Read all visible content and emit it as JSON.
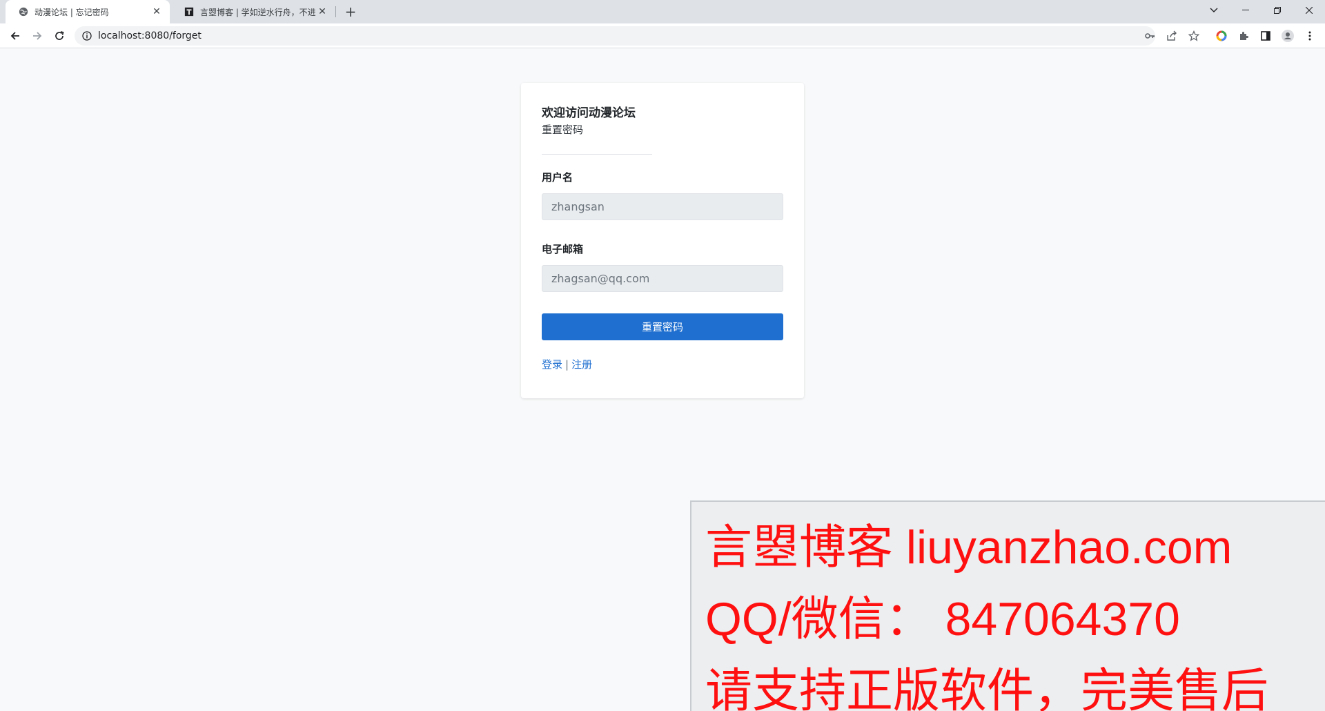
{
  "browser": {
    "tabs": [
      {
        "title": "动漫论坛 | 忘记密码",
        "active": true,
        "favicon": "globe-icon"
      },
      {
        "title": "言曌博客 | 学如逆水行舟，不进则退",
        "active": false,
        "favicon": "blog-favicon-icon"
      }
    ],
    "new_tab_label": "+",
    "url": "localhost:8080/forget"
  },
  "page": {
    "title": "欢迎访问动漫论坛",
    "subtitle": "重置密码",
    "username": {
      "label": "用户名",
      "value": "zhangsan"
    },
    "email": {
      "label": "电子邮箱",
      "value": "zhagsan@qq.com"
    },
    "submit_label": "重置密码",
    "links": {
      "login": "登录",
      "separator": "|",
      "register": "注册"
    }
  },
  "watermark": {
    "line1": "言曌博客 liuyanzhao.com",
    "line2": "QQ/微信：  847064370",
    "line3": "请支持正版软件，完美售后"
  },
  "colors": {
    "primary": "#1f6fd0",
    "watermark_text": "#ff1010",
    "page_background": "#f8f9fa",
    "tabstrip_background": "#dee1e6"
  }
}
